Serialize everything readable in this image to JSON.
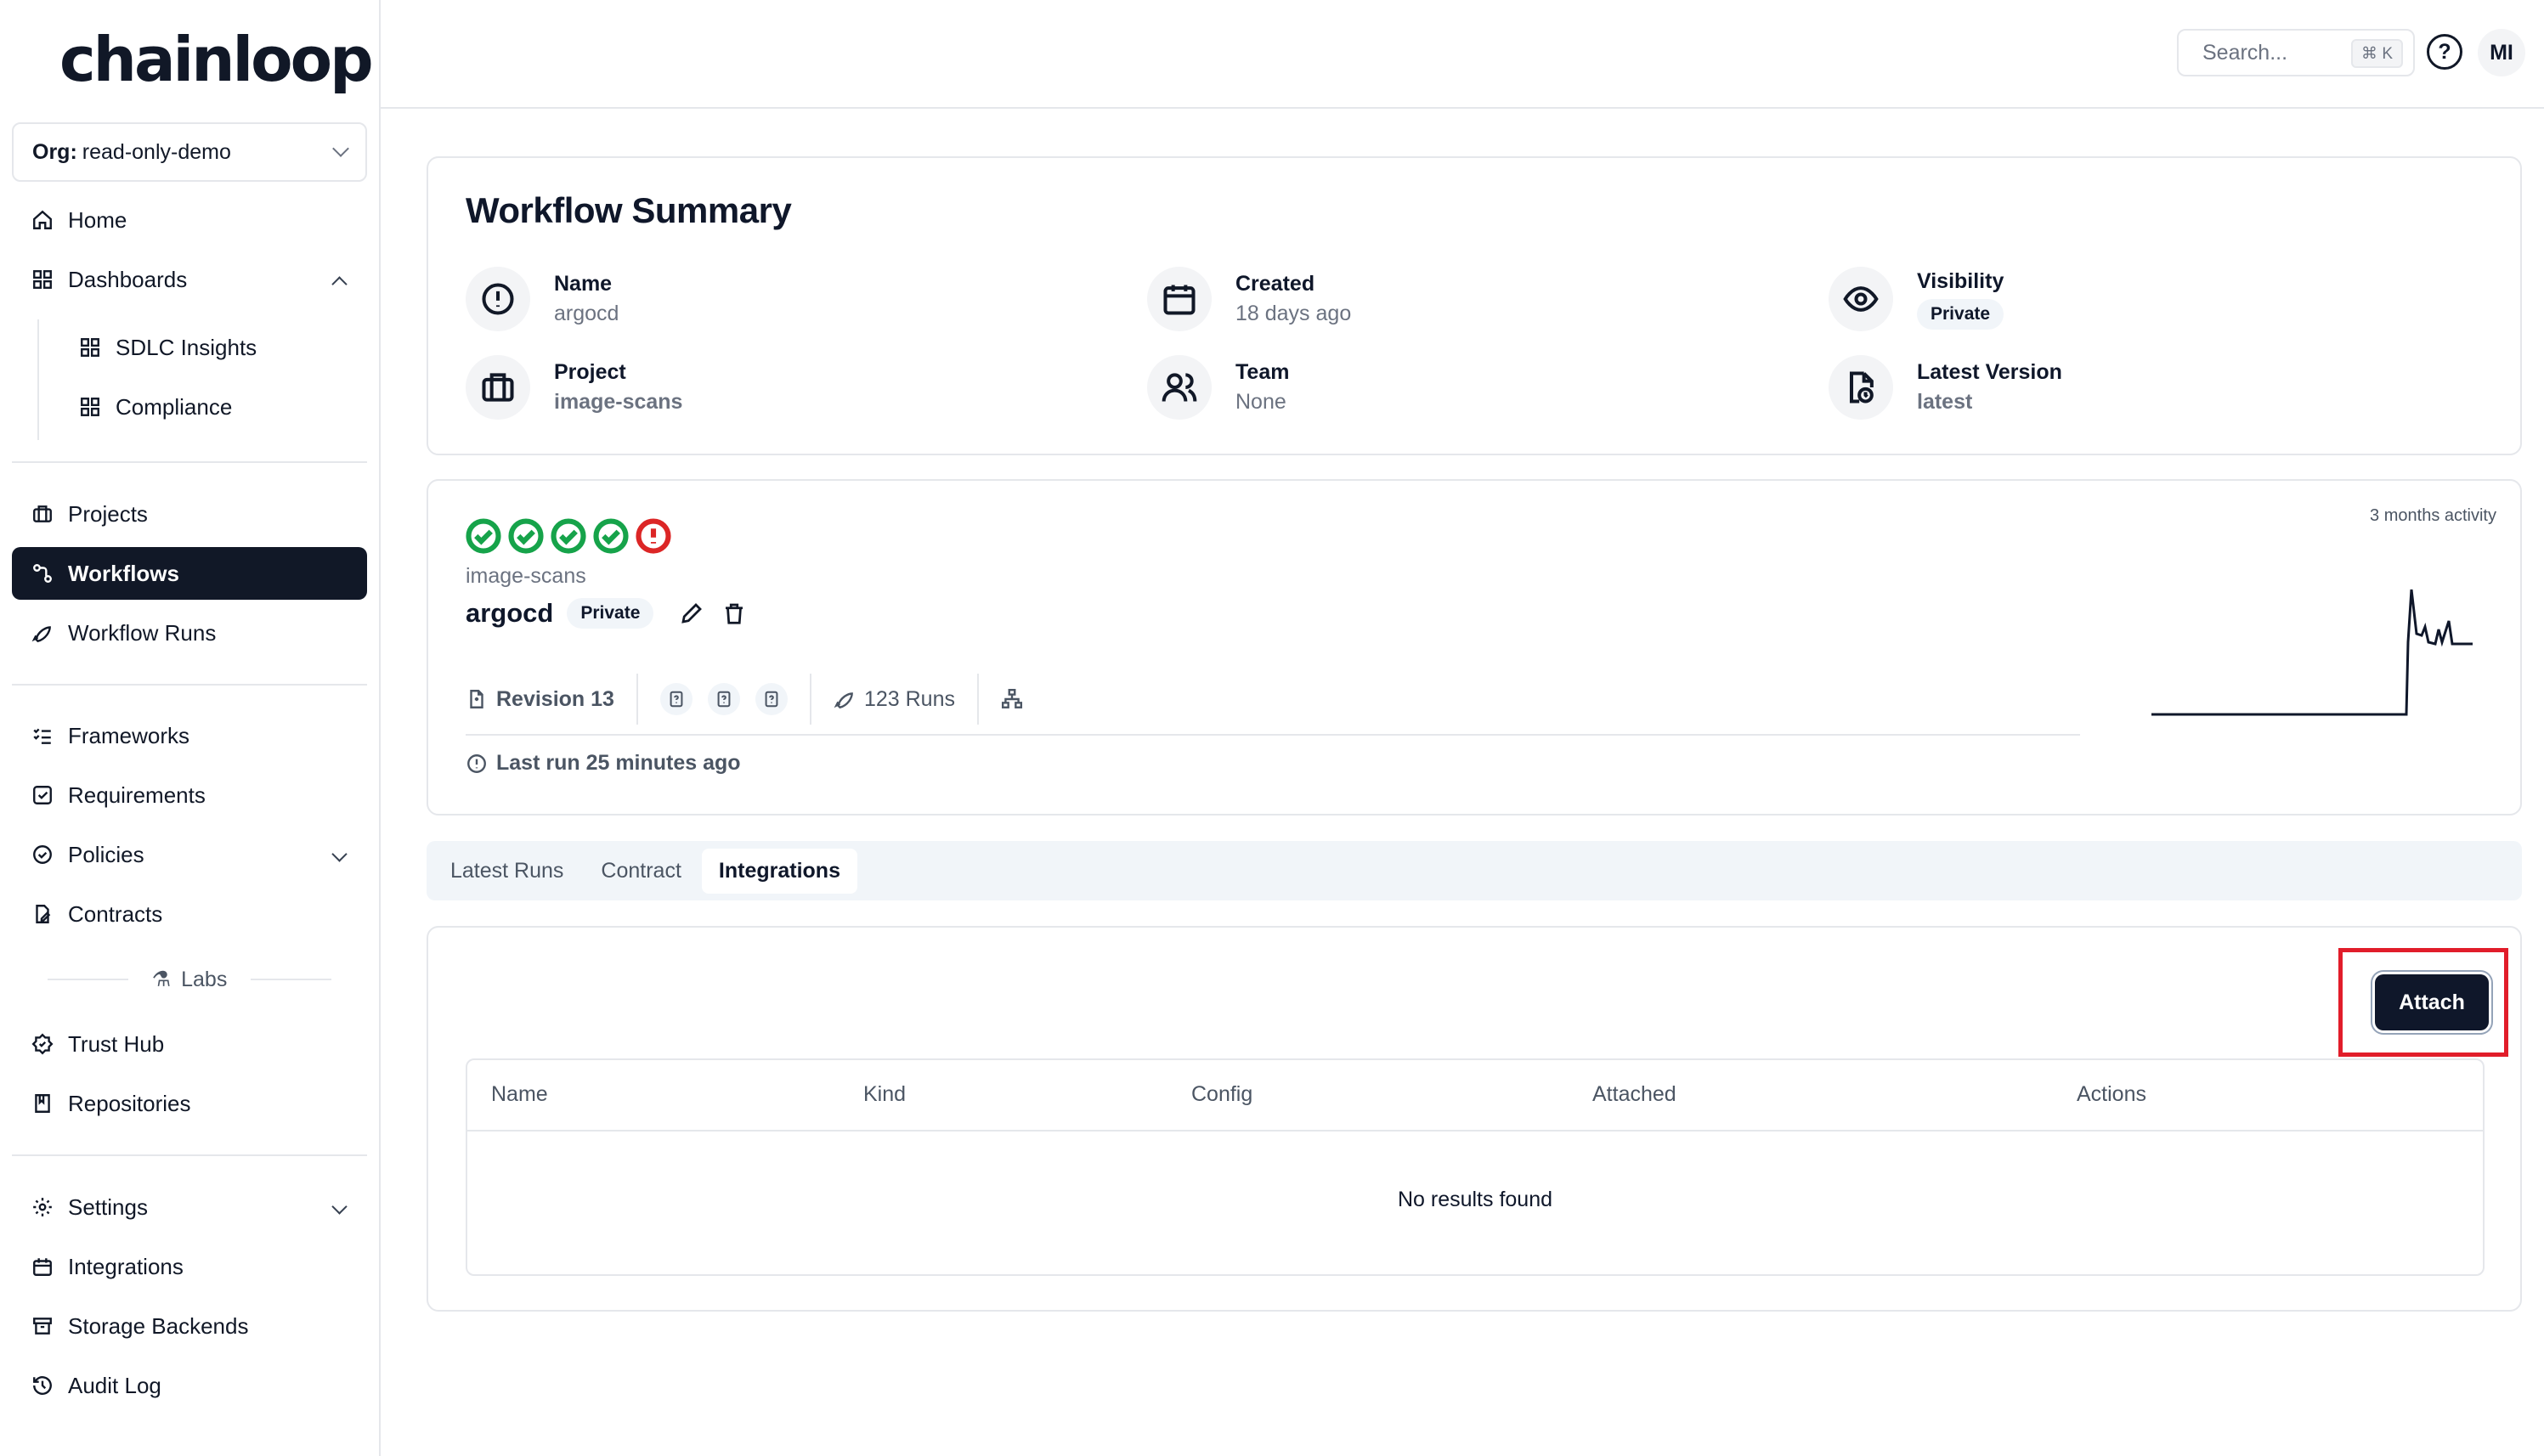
{
  "app": {
    "logo": "chainloop"
  },
  "sidebar": {
    "org_label": "Org:",
    "org_value": "read-only-demo",
    "items": [
      {
        "label": "Home",
        "icon": "home-icon"
      },
      {
        "label": "Dashboards",
        "icon": "dashboard-icon"
      },
      {
        "label": "SDLC Insights",
        "icon": "dashboard-icon"
      },
      {
        "label": "Compliance",
        "icon": "dashboard-icon"
      },
      {
        "label": "Projects",
        "icon": "briefcase-icon"
      },
      {
        "label": "Workflows",
        "icon": "workflow-icon"
      },
      {
        "label": "Workflow Runs",
        "icon": "rocket-icon"
      },
      {
        "label": "Frameworks",
        "icon": "list-check-icon"
      },
      {
        "label": "Requirements",
        "icon": "checkbox-icon"
      },
      {
        "label": "Policies",
        "icon": "check-circle-icon"
      },
      {
        "label": "Contracts",
        "icon": "file-edit-icon"
      },
      {
        "label": "Trust Hub",
        "icon": "badge-icon"
      },
      {
        "label": "Repositories",
        "icon": "book-icon"
      },
      {
        "label": "Settings",
        "icon": "gear-icon"
      },
      {
        "label": "Integrations",
        "icon": "calendar-icon"
      },
      {
        "label": "Storage Backends",
        "icon": "archive-icon"
      },
      {
        "label": "Audit Log",
        "icon": "history-icon"
      }
    ],
    "labs_label": "Labs"
  },
  "topbar": {
    "search_placeholder": "Search...",
    "search_shortcut": "⌘ K",
    "help": "?",
    "avatar": "MI"
  },
  "summary": {
    "title": "Workflow Summary",
    "name_label": "Name",
    "name_value": "argocd",
    "created_label": "Created",
    "created_value": "18 days ago",
    "visibility_label": "Visibility",
    "visibility_value": "Private",
    "project_label": "Project",
    "project_value": "image-scans",
    "team_label": "Team",
    "team_value": "None",
    "version_label": "Latest Version",
    "version_value": "latest"
  },
  "workflow": {
    "run_statuses": [
      "success",
      "success",
      "success",
      "success",
      "error"
    ],
    "project": "image-scans",
    "name": "argocd",
    "visibility": "Private",
    "revision": "Revision 13",
    "runs": "123 Runs",
    "last_run": "Last run 25 minutes ago",
    "activity_label": "3 months activity",
    "status_colors": {
      "success": "#16a34a",
      "error": "#dc2626"
    }
  },
  "tabs": [
    {
      "label": "Latest Runs",
      "active": false
    },
    {
      "label": "Contract",
      "active": false
    },
    {
      "label": "Integrations",
      "active": true
    }
  ],
  "integrations": {
    "attach_label": "Attach",
    "columns": [
      "Name",
      "Kind",
      "Config",
      "Attached",
      "Actions"
    ],
    "empty_text": "No results found",
    "highlight_color": "#e11d2a"
  }
}
